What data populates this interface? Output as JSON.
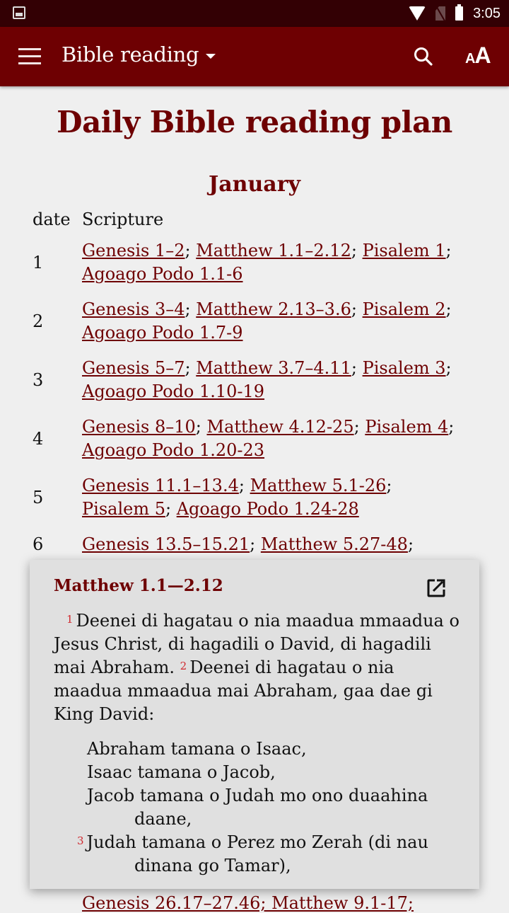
{
  "status_bar": {
    "time": "3:05",
    "icons": [
      "image-notification-icon",
      "wifi-icon",
      "no-sim-icon",
      "battery-icon"
    ]
  },
  "app_bar": {
    "title": "Bible reading",
    "menu_icon": "hamburger-menu-icon",
    "dropdown_icon": "caret-down-icon",
    "search_icon": "search-icon",
    "font_size_label_small": "A",
    "font_size_label_large": "A"
  },
  "colors": {
    "primary": "#6e0002",
    "status_bar": "#330004",
    "background": "#efefef",
    "popup_bg": "#e0e0e0",
    "verse_number": "#d0282e"
  },
  "page": {
    "title": "Daily Bible reading plan",
    "month": "January",
    "table": {
      "headers": [
        "date",
        "Scripture"
      ],
      "rows": [
        {
          "date": "1",
          "refs": [
            "Genesis 1–2",
            "Matthew 1.1–2.12",
            "Pisalem 1",
            "Agoago Podo 1.1-6"
          ]
        },
        {
          "date": "2",
          "refs": [
            "Genesis 3–4",
            "Matthew 2.13–3.6",
            "Pisalem 2",
            "Agoago Podo 1.7-9"
          ]
        },
        {
          "date": "3",
          "refs": [
            "Genesis 5–7",
            "Matthew 3.7–4.11",
            "Pisalem 3",
            "Agoago Podo 1.10-19"
          ]
        },
        {
          "date": "4",
          "refs": [
            "Genesis 8–10",
            "Matthew 4.12-25",
            "Pisalem 4",
            "Agoago Podo 1.20-23"
          ]
        },
        {
          "date": "5",
          "refs": [
            "Genesis 11.1–13.4",
            "Matthew 5.1-26",
            "Pisalem 5",
            "Agoago Podo 1.24-28"
          ]
        },
        {
          "date": "6",
          "refs": [
            "Genesis 13.5–15.21",
            "Matthew 5.27-48"
          ]
        }
      ],
      "peek_row_text": "Genesis 26.17–27.46; Matthew 9.1-17;"
    }
  },
  "popup": {
    "title": "Matthew 1.1—2.12",
    "open_icon": "open-in-new-icon",
    "verse1_num": "1",
    "verse1_text": "Deenei di hagatau o nia maadua mmaadua o Jesus Christ, di hagadili o David, di hagadili mai Abraham.",
    "verse2_num": "2",
    "verse2_text": "Deenei di hagatau o nia maadua mmaadua mai Abraham, gaa dae gi King David:",
    "poetry": [
      {
        "num": "",
        "text": "Abraham tamana o Isaac,"
      },
      {
        "num": "",
        "text": "Isaac tamana o Jacob,"
      },
      {
        "num": "",
        "text": "Jacob tamana o Judah mo ono duaahina daane,"
      },
      {
        "num": "3",
        "text": "Judah tamana o Perez mo Zerah (di nau dinana go Tamar),"
      }
    ]
  }
}
